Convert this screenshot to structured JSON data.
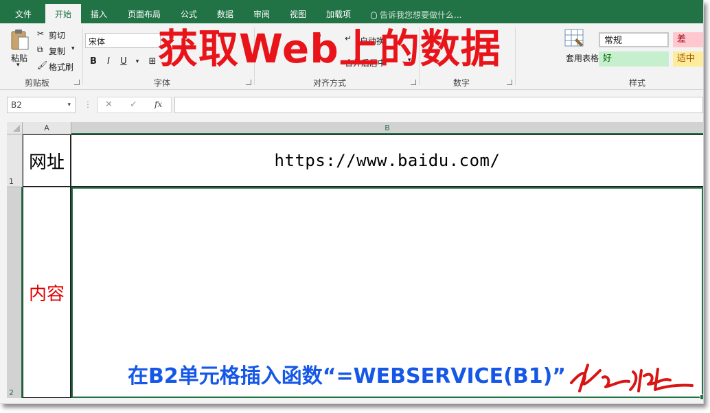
{
  "tabs": [
    {
      "label": "文件"
    },
    {
      "label": "开始"
    },
    {
      "label": "插入"
    },
    {
      "label": "页面布局"
    },
    {
      "label": "公式"
    },
    {
      "label": "数据"
    },
    {
      "label": "审阅"
    },
    {
      "label": "视图"
    },
    {
      "label": "加载项"
    }
  ],
  "tell_me": "告诉我您想要做什么...",
  "clipboard": {
    "paste": "粘贴",
    "cut": "剪切",
    "copy": "复制",
    "format_painter": "格式刷",
    "group_label": "剪贴板"
  },
  "font": {
    "name": "宋体",
    "bold": "B",
    "italic": "I",
    "underline": "U",
    "group_label": "字体"
  },
  "alignment": {
    "wrap_text": "自动换",
    "merge_center": "合并后居中",
    "group_label": "对齐方式"
  },
  "number": {
    "group_label": "数字"
  },
  "styles": {
    "format_as_table": "套用表格格式",
    "normal": "常规",
    "bad": "差",
    "good": "好",
    "neutral": "适中",
    "group_label": "样式"
  },
  "formula_bar": {
    "name_box": "B2",
    "cancel": "✕",
    "enter": "✓",
    "fx": "fx",
    "formula": ""
  },
  "sheet": {
    "columns": [
      "A",
      "B"
    ],
    "rows": [
      {
        "number": "1",
        "a": "网址",
        "b": "https://www.baidu.com/"
      },
      {
        "number": "2",
        "a": "内容",
        "b": ""
      }
    ]
  },
  "overlay": {
    "title": "获取Web上的数据",
    "instruction": "在B2单元格插入函数“=WEBSERVICE(B1)”"
  },
  "colors": {
    "excel_green": "#217346",
    "title_red": "#e8141a",
    "instruction_blue": "#1557e6",
    "content_label_red": "#e00000",
    "bad_fill": "#ffc7ce",
    "good_fill": "#c6efce",
    "neutral_fill": "#ffeb9c"
  }
}
